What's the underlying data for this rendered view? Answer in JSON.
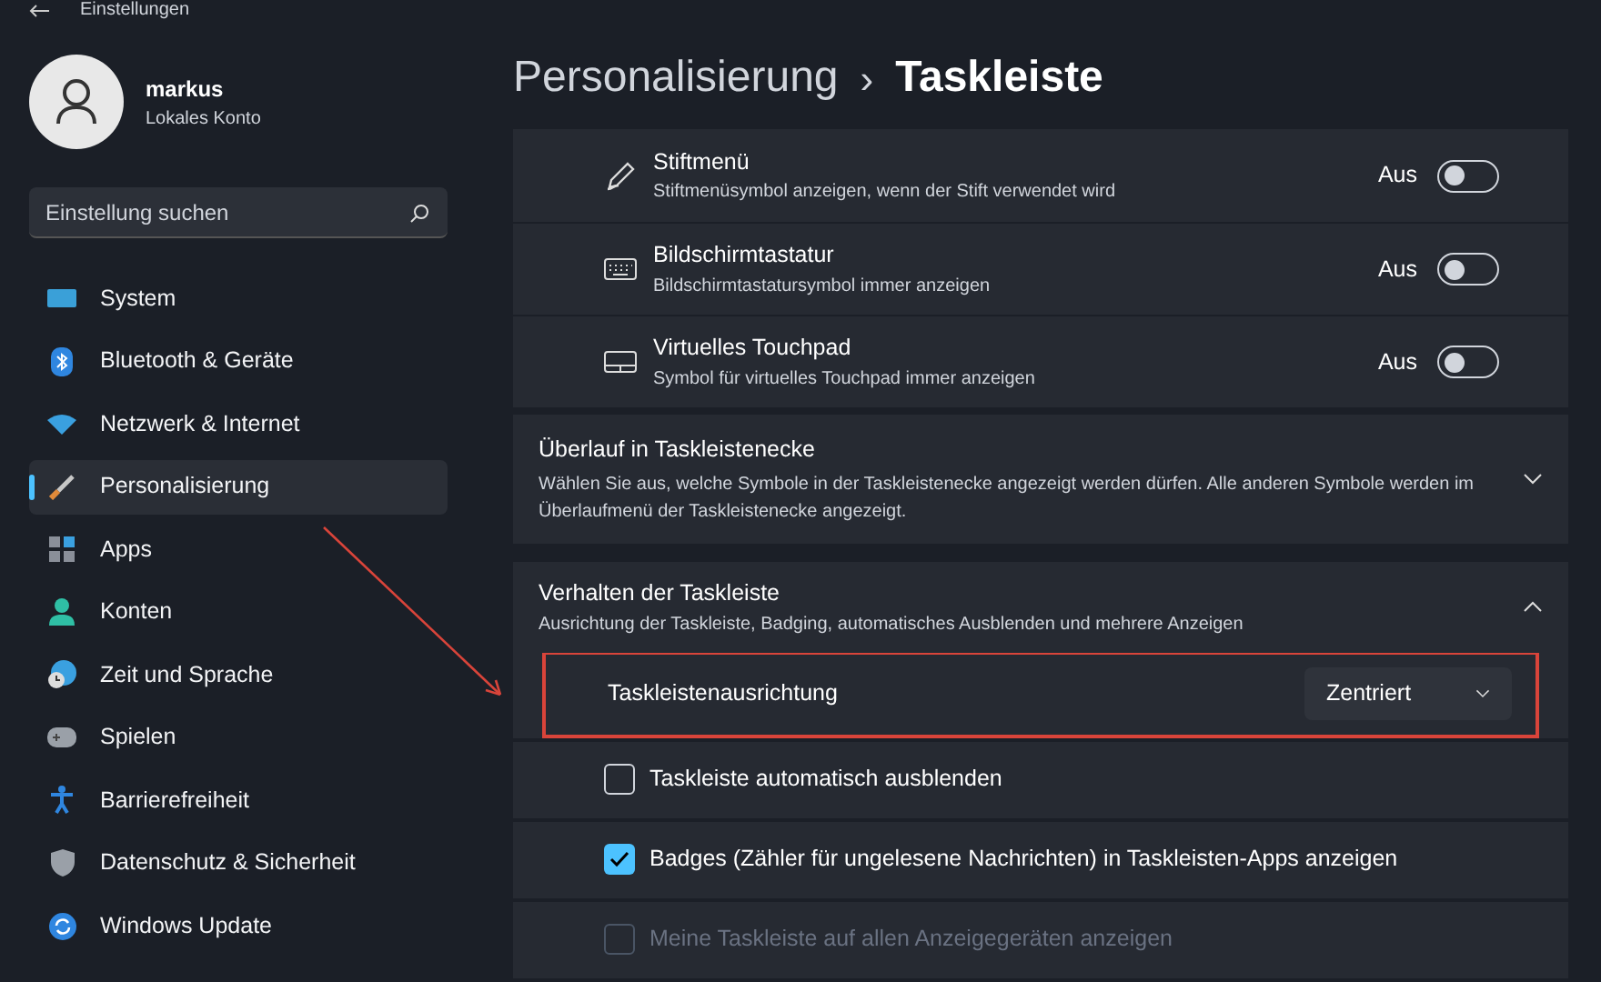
{
  "window": {
    "title": "Einstellungen"
  },
  "account": {
    "name": "markus",
    "type": "Lokales Konto"
  },
  "search": {
    "placeholder": "Einstellung suchen"
  },
  "sidebar": {
    "items": [
      {
        "label": "System",
        "selected": false
      },
      {
        "label": "Bluetooth & Geräte",
        "selected": false
      },
      {
        "label": "Netzwerk & Internet",
        "selected": false
      },
      {
        "label": "Personalisierung",
        "selected": true
      },
      {
        "label": "Apps",
        "selected": false
      },
      {
        "label": "Konten",
        "selected": false
      },
      {
        "label": "Zeit und Sprache",
        "selected": false
      },
      {
        "label": "Spielen",
        "selected": false
      },
      {
        "label": "Barrierefreiheit",
        "selected": false
      },
      {
        "label": "Datenschutz & Sicherheit",
        "selected": false
      },
      {
        "label": "Windows Update",
        "selected": false
      }
    ]
  },
  "breadcrumb": {
    "parent": "Personalisierung",
    "separator": "›",
    "current": "Taskleiste"
  },
  "toggle_rows": [
    {
      "title": "Stiftmenü",
      "description": "Stiftmenüsymbol anzeigen, wenn der Stift verwendet wird",
      "state_label": "Aus",
      "on": false
    },
    {
      "title": "Bildschirmtastatur",
      "description": "Bildschirmtastatursymbol immer anzeigen",
      "state_label": "Aus",
      "on": false
    },
    {
      "title": "Virtuelles Touchpad",
      "description": "Symbol für virtuelles Touchpad immer anzeigen",
      "state_label": "Aus",
      "on": false
    }
  ],
  "overflow_section": {
    "title": "Überlauf in Taskleistenecke",
    "description": "Wählen Sie aus, welche Symbole in der Taskleistenecke angezeigt werden dürfen. Alle anderen Symbole werden im Überlaufmenü der Taskleistenecke angezeigt.",
    "expanded": false
  },
  "behavior_section": {
    "title": "Verhalten der Taskleiste",
    "description": "Ausrichtung der Taskleiste, Badging, automatisches Ausblenden und mehrere Anzeigen",
    "expanded": true,
    "alignment": {
      "label": "Taskleistenausrichtung",
      "value": "Zentriert",
      "highlighted": true
    },
    "checkboxes": [
      {
        "label": "Taskleiste automatisch ausblenden",
        "checked": false,
        "disabled": false
      },
      {
        "label": "Badges (Zähler für ungelesene Nachrichten) in Taskleisten-Apps anzeigen",
        "checked": true,
        "disabled": false
      },
      {
        "label": "Meine Taskleiste auf allen Anzeigegeräten anzeigen",
        "checked": false,
        "disabled": true
      }
    ]
  }
}
